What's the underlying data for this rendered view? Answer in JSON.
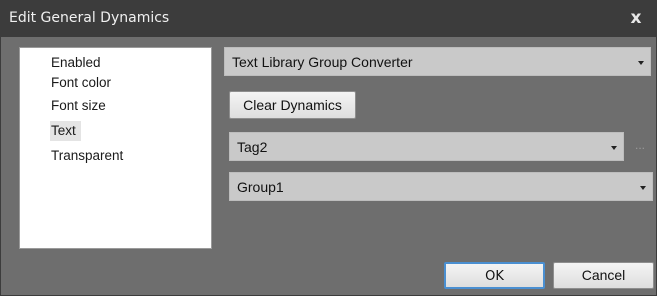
{
  "dialog": {
    "title": "Edit General Dynamics",
    "close_glyph": "x"
  },
  "property_list": {
    "items": [
      {
        "label": "Enabled"
      },
      {
        "label": "Font color"
      },
      {
        "label": "Font size"
      },
      {
        "label": "Text",
        "selected": true
      },
      {
        "label": "Transparent"
      }
    ]
  },
  "converter_select": {
    "value": "Text Library Group Converter"
  },
  "clear_dynamics_button": {
    "label": "Clear Dynamics"
  },
  "tag_select": {
    "value": "Tag2"
  },
  "tag_browse": {
    "label": "..."
  },
  "group_select": {
    "value": "Group1"
  },
  "footer": {
    "ok_label": "OK",
    "cancel_label": "Cancel"
  },
  "colors": {
    "background": "#6e6e6e",
    "titlebar": "#3c3c3c",
    "combo": "#c9c9c9",
    "ok_accent_border": "#4a8fd1"
  }
}
